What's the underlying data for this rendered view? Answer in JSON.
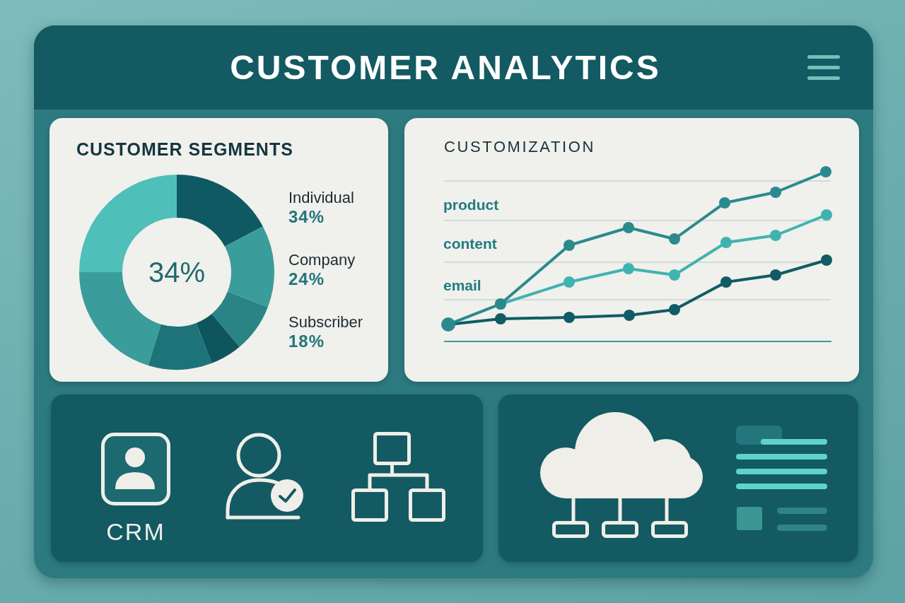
{
  "header": {
    "title": "CUSTOMER ANALYTICS"
  },
  "segments_card": {
    "title": "CUSTOMER SEGMENTS",
    "center_value": "34%",
    "legend": [
      {
        "label": "Individual",
        "value": "34%"
      },
      {
        "label": "Company",
        "value": "24%"
      },
      {
        "label": "Subscriber",
        "value": "18%"
      }
    ]
  },
  "customization_card": {
    "title": "CUSTOMIZATION",
    "series": [
      {
        "name": "product"
      },
      {
        "name": "content"
      },
      {
        "name": "email"
      }
    ]
  },
  "tools_card": {
    "label": "CRM"
  }
}
